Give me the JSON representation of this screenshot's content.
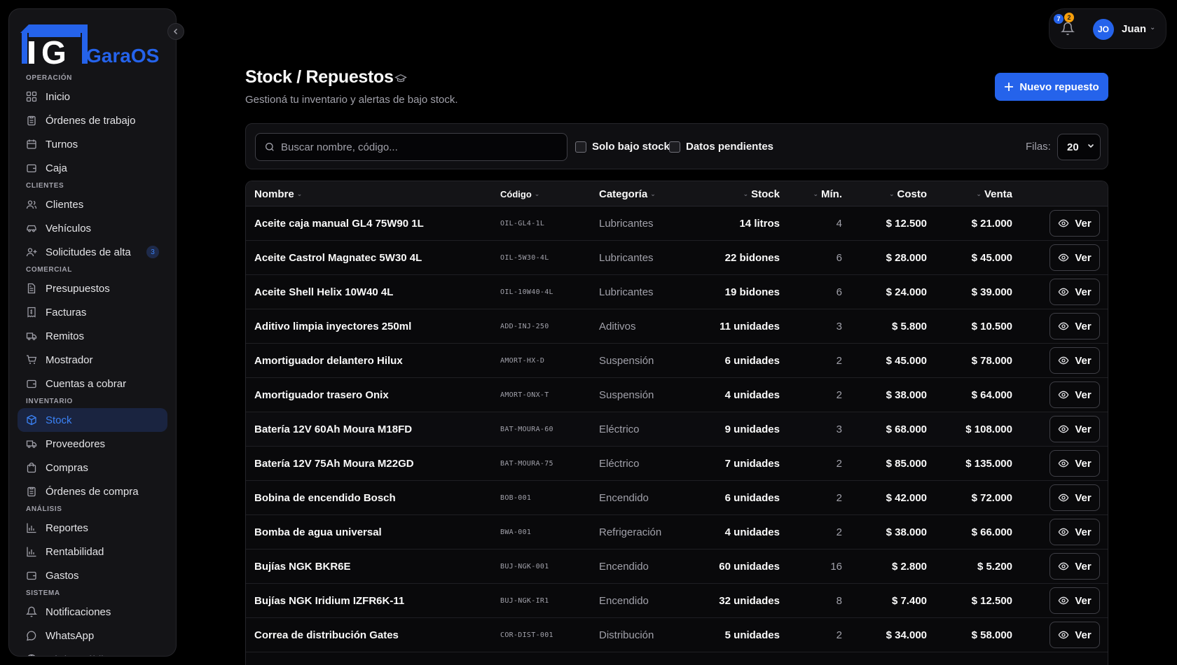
{
  "app": {
    "logo_text": "GaraOS",
    "logo_letter": "G",
    "brand_color": "#2563eb"
  },
  "sidebar": {
    "sections": [
      {
        "title": "OPERACIÓN",
        "items": [
          {
            "label": "Inicio",
            "icon": "grid-icon"
          },
          {
            "label": "Órdenes de trabajo",
            "icon": "clipboard-icon"
          },
          {
            "label": "Turnos",
            "icon": "calendar-icon"
          },
          {
            "label": "Caja",
            "icon": "wallet-icon"
          }
        ]
      },
      {
        "title": "CLIENTES",
        "items": [
          {
            "label": "Clientes",
            "icon": "users-icon"
          },
          {
            "label": "Vehículos",
            "icon": "car-icon"
          },
          {
            "label": "Solicitudes de alta",
            "icon": "user-plus-icon",
            "count": "3"
          }
        ]
      },
      {
        "title": "COMERCIAL",
        "items": [
          {
            "label": "Presupuestos",
            "icon": "file-text-icon"
          },
          {
            "label": "Facturas",
            "icon": "receipt-icon"
          },
          {
            "label": "Remitos",
            "icon": "truck-icon"
          },
          {
            "label": "Mostrador",
            "icon": "cart-icon"
          },
          {
            "label": "Cuentas a cobrar",
            "icon": "wallet-icon"
          }
        ]
      },
      {
        "title": "INVENTARIO",
        "items": [
          {
            "label": "Stock",
            "icon": "box-icon",
            "active": true
          },
          {
            "label": "Proveedores",
            "icon": "truck-icon"
          },
          {
            "label": "Compras",
            "icon": "bag-icon"
          },
          {
            "label": "Órdenes de compra",
            "icon": "clipboard-icon"
          }
        ]
      },
      {
        "title": "ANÁLISIS",
        "items": [
          {
            "label": "Reportes",
            "icon": "bar-chart-icon"
          },
          {
            "label": "Rentabilidad",
            "icon": "bar-chart-icon"
          },
          {
            "label": "Gastos",
            "icon": "wallet-icon"
          }
        ]
      },
      {
        "title": "SISTEMA",
        "items": [
          {
            "label": "Notificaciones",
            "icon": "bell-icon"
          },
          {
            "label": "WhatsApp",
            "icon": "chat-icon"
          },
          {
            "label": "Página pública",
            "icon": "globe-icon",
            "faded": true
          }
        ]
      }
    ]
  },
  "header": {
    "notification_badges": [
      "7",
      "2"
    ],
    "user_initials": "JO",
    "user_name": "Juan"
  },
  "page": {
    "title": "Stock / Repuestos",
    "subtitle": "Gestioná tu inventario y alertas de bajo stock.",
    "new_button": "Nuevo repuesto"
  },
  "filters": {
    "search_placeholder": "Buscar nombre, código...",
    "low_stock_label": "Solo bajo stock",
    "pending_label": "Datos pendientes",
    "rows_label": "Filas:",
    "rows_value": "20"
  },
  "table": {
    "columns": {
      "name": "Nombre",
      "code": "Código",
      "category": "Categoría",
      "stock": "Stock",
      "min": "Mín.",
      "cost": "Costo",
      "sale": "Venta"
    },
    "action_label": "Ver",
    "rows": [
      {
        "name": "Aceite caja manual GL4 75W90 1L",
        "code": "OIL-GL4-1L",
        "category": "Lubricantes",
        "stock": "14 litros",
        "min": "4",
        "cost": "$ 12.500",
        "sale": "$ 21.000"
      },
      {
        "name": "Aceite Castrol Magnatec 5W30 4L",
        "code": "OIL-5W30-4L",
        "category": "Lubricantes",
        "stock": "22 bidones",
        "min": "6",
        "cost": "$ 28.000",
        "sale": "$ 45.000"
      },
      {
        "name": "Aceite Shell Helix 10W40 4L",
        "code": "OIL-10W40-4L",
        "category": "Lubricantes",
        "stock": "19 bidones",
        "min": "6",
        "cost": "$ 24.000",
        "sale": "$ 39.000"
      },
      {
        "name": "Aditivo limpia inyectores 250ml",
        "code": "ADD-INJ-250",
        "category": "Aditivos",
        "stock": "11 unidades",
        "min": "3",
        "cost": "$ 5.800",
        "sale": "$ 10.500"
      },
      {
        "name": "Amortiguador delantero Hilux",
        "code": "AMORT-HX-D",
        "category": "Suspensión",
        "stock": "6 unidades",
        "min": "2",
        "cost": "$ 45.000",
        "sale": "$ 78.000"
      },
      {
        "name": "Amortiguador trasero Onix",
        "code": "AMORT-ONX-T",
        "category": "Suspensión",
        "stock": "4 unidades",
        "min": "2",
        "cost": "$ 38.000",
        "sale": "$ 64.000"
      },
      {
        "name": "Batería 12V 60Ah Moura M18FD",
        "code": "BAT-MOURA-60",
        "category": "Eléctrico",
        "stock": "9 unidades",
        "min": "3",
        "cost": "$ 68.000",
        "sale": "$ 108.000"
      },
      {
        "name": "Batería 12V 75Ah Moura M22GD",
        "code": "BAT-MOURA-75",
        "category": "Eléctrico",
        "stock": "7 unidades",
        "min": "2",
        "cost": "$ 85.000",
        "sale": "$ 135.000"
      },
      {
        "name": "Bobina de encendido Bosch",
        "code": "BOB-001",
        "category": "Encendido",
        "stock": "6 unidades",
        "min": "2",
        "cost": "$ 42.000",
        "sale": "$ 72.000"
      },
      {
        "name": "Bomba de agua universal",
        "code": "BWA-001",
        "category": "Refrigeración",
        "stock": "4 unidades",
        "min": "2",
        "cost": "$ 38.000",
        "sale": "$ 66.000"
      },
      {
        "name": "Bujías NGK BKR6E",
        "code": "BUJ-NGK-001",
        "category": "Encendido",
        "stock": "60 unidades",
        "min": "16",
        "cost": "$ 2.800",
        "sale": "$ 5.200"
      },
      {
        "name": "Bujías NGK Iridium IZFR6K-11",
        "code": "BUJ-NGK-IR1",
        "category": "Encendido",
        "stock": "32 unidades",
        "min": "8",
        "cost": "$ 7.400",
        "sale": "$ 12.500"
      },
      {
        "name": "Correa de distribución Gates",
        "code": "COR-DIST-001",
        "category": "Distribución",
        "stock": "5 unidades",
        "min": "2",
        "cost": "$ 34.000",
        "sale": "$ 58.000"
      }
    ]
  }
}
